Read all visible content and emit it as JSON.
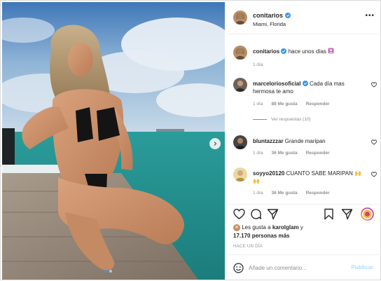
{
  "header": {
    "username": "conitarios",
    "location": "Miami, Florida",
    "more": "•••"
  },
  "caption": {
    "username": "conitarios",
    "text": "hace unos días",
    "time": "1 día"
  },
  "comments": [
    {
      "username": "marceloriosoficial",
      "text": "Cada día mas hermosa te amo",
      "time": "1 día",
      "likes": "88 Me gusta",
      "reply": "Responder",
      "replies": "Ver respuestas (10)"
    },
    {
      "username": "bluntazzzar",
      "text": "Grande maripan",
      "time": "1 día",
      "likes": "36 Me gusta",
      "reply": "Responder"
    },
    {
      "username": "soyyo20120",
      "text": "CUANTO SABE MARIPAN 🙌🙌",
      "time": "1 día",
      "likes": "36 Me gusta",
      "reply": "Responder"
    }
  ],
  "likes": {
    "prefix": "Les gusta a",
    "user": "karolglam",
    "joiner": "y",
    "others": "17.170 personas más"
  },
  "posted": "HACE UN DÍA",
  "comment_box": {
    "placeholder": "Añade un comentario...",
    "publish": "Publicar"
  },
  "colors": {
    "verified": "#3897f0",
    "muted": "#8e8e8e",
    "publish_disabled": "#b3dbff"
  },
  "icons": [
    "verified-badge-icon",
    "heart-icon",
    "comment-icon",
    "share-icon",
    "save-icon",
    "emoji-icon",
    "chevron-right-icon"
  ]
}
